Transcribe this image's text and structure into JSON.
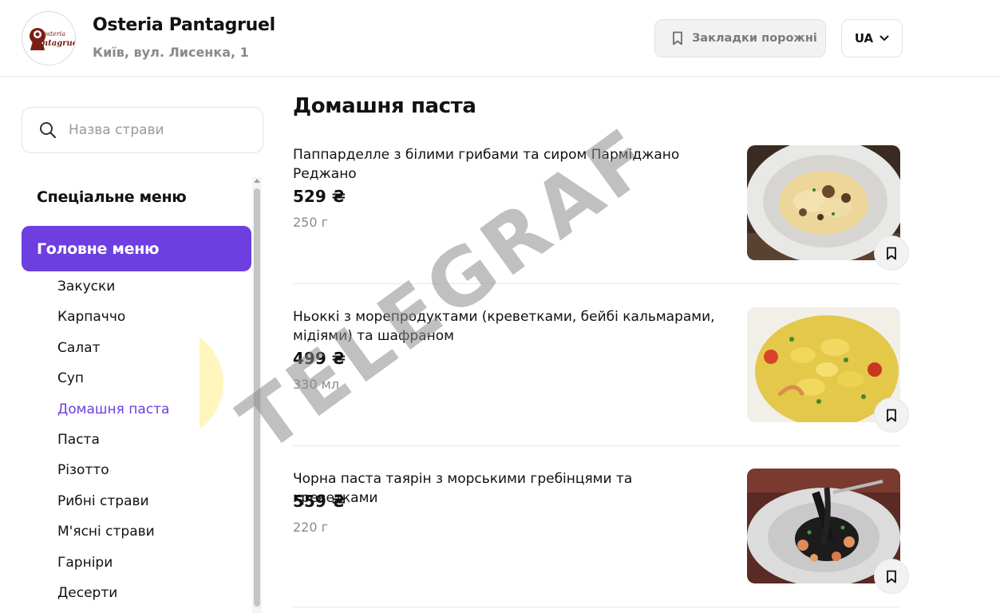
{
  "header": {
    "restaurant_name": "Osteria Pantagruel",
    "address": "Київ, вул. Лисенка, 1",
    "logo_text_top": "osteria",
    "logo_text_main": "Pantagruel",
    "bookmarks_label": "Закладки порожні",
    "language": "UA"
  },
  "sidebar": {
    "search_placeholder": "Назва страви",
    "special_menu": "Спеціальне меню",
    "main_menu": "Головне меню",
    "categories": [
      "Закуски",
      "Карпаччо",
      "Салат",
      "Суп",
      "Домашня паста",
      "Паста",
      "Різотто",
      "Рибні страви",
      "М'ясні страви",
      "Гарніри",
      "Десерти"
    ],
    "active_category": "Домашня паста"
  },
  "content": {
    "section_title": "Домашня паста",
    "dishes": [
      {
        "name": "Паппарделле з білими грибами та сиром Парміджано Реджано",
        "price": "529 ₴",
        "weight": "250 г"
      },
      {
        "name": "Ньоккі з морепродуктами (креветками, бейбі кальмарами, мідіями) та шафраном",
        "price": "499 ₴",
        "weight": "330 мл"
      },
      {
        "name": "Чорна паста таярін з морськими гребінцями та креветками",
        "price": "559 ₴",
        "weight": "220 г"
      }
    ]
  },
  "watermark": {
    "text": "TELEGRAF"
  },
  "colors": {
    "accent": "#6d3ee0",
    "muted_text": "#8a8a8a",
    "logo_brown": "#7a1f14"
  }
}
